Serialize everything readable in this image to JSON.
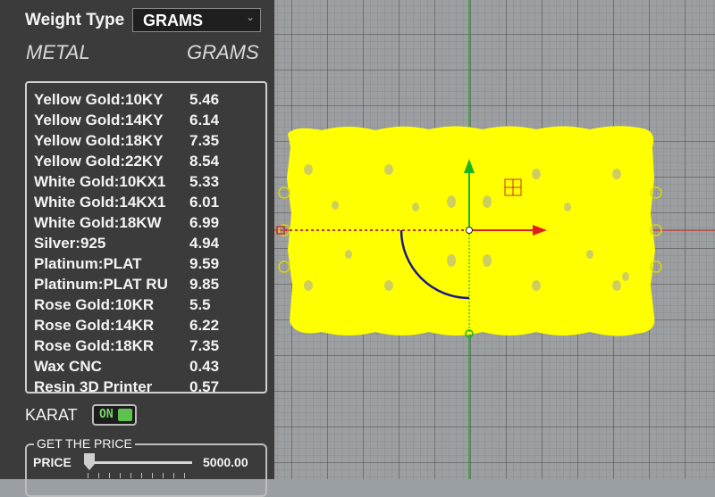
{
  "panel": {
    "weight_type_label": "Weight Type",
    "weight_type_value": "GRAMS",
    "col_metal": "METAL",
    "col_grams": "GRAMS",
    "metals": [
      {
        "name": "Yellow Gold:10KY",
        "grams": "5.46"
      },
      {
        "name": "Yellow Gold:14KY",
        "grams": "6.14"
      },
      {
        "name": "Yellow Gold:18KY",
        "grams": "7.35"
      },
      {
        "name": "Yellow Gold:22KY",
        "grams": "8.54"
      },
      {
        "name": "White Gold:10KX1",
        "grams": "5.33"
      },
      {
        "name": "White Gold:14KX1",
        "grams": "6.01"
      },
      {
        "name": "White Gold:18KW",
        "grams": "6.99"
      },
      {
        "name": "Silver:925",
        "grams": "4.94"
      },
      {
        "name": "Platinum:PLAT",
        "grams": "9.59"
      },
      {
        "name": "Platinum:PLAT RU",
        "grams": "9.85"
      },
      {
        "name": "Rose Gold:10KR",
        "grams": "5.5"
      },
      {
        "name": "Rose Gold:14KR",
        "grams": "6.22"
      },
      {
        "name": "Rose Gold:18KR",
        "grams": "7.35"
      },
      {
        "name": "Wax  CNC",
        "grams": "0.43"
      },
      {
        "name": "Resin 3D Printer",
        "grams": "0.57"
      }
    ],
    "karat_label": "KARAT",
    "karat_toggle": "ON",
    "price_group_title": "GET THE PRICE",
    "price_label": "PRICE",
    "price_value": "5000.00"
  },
  "colors": {
    "panel_bg": "#3b3b3b",
    "object_yellow": "#ffff00",
    "axis_green": "#1db31d",
    "axis_red": "#e02020",
    "toggle_green": "#5ec14d"
  }
}
